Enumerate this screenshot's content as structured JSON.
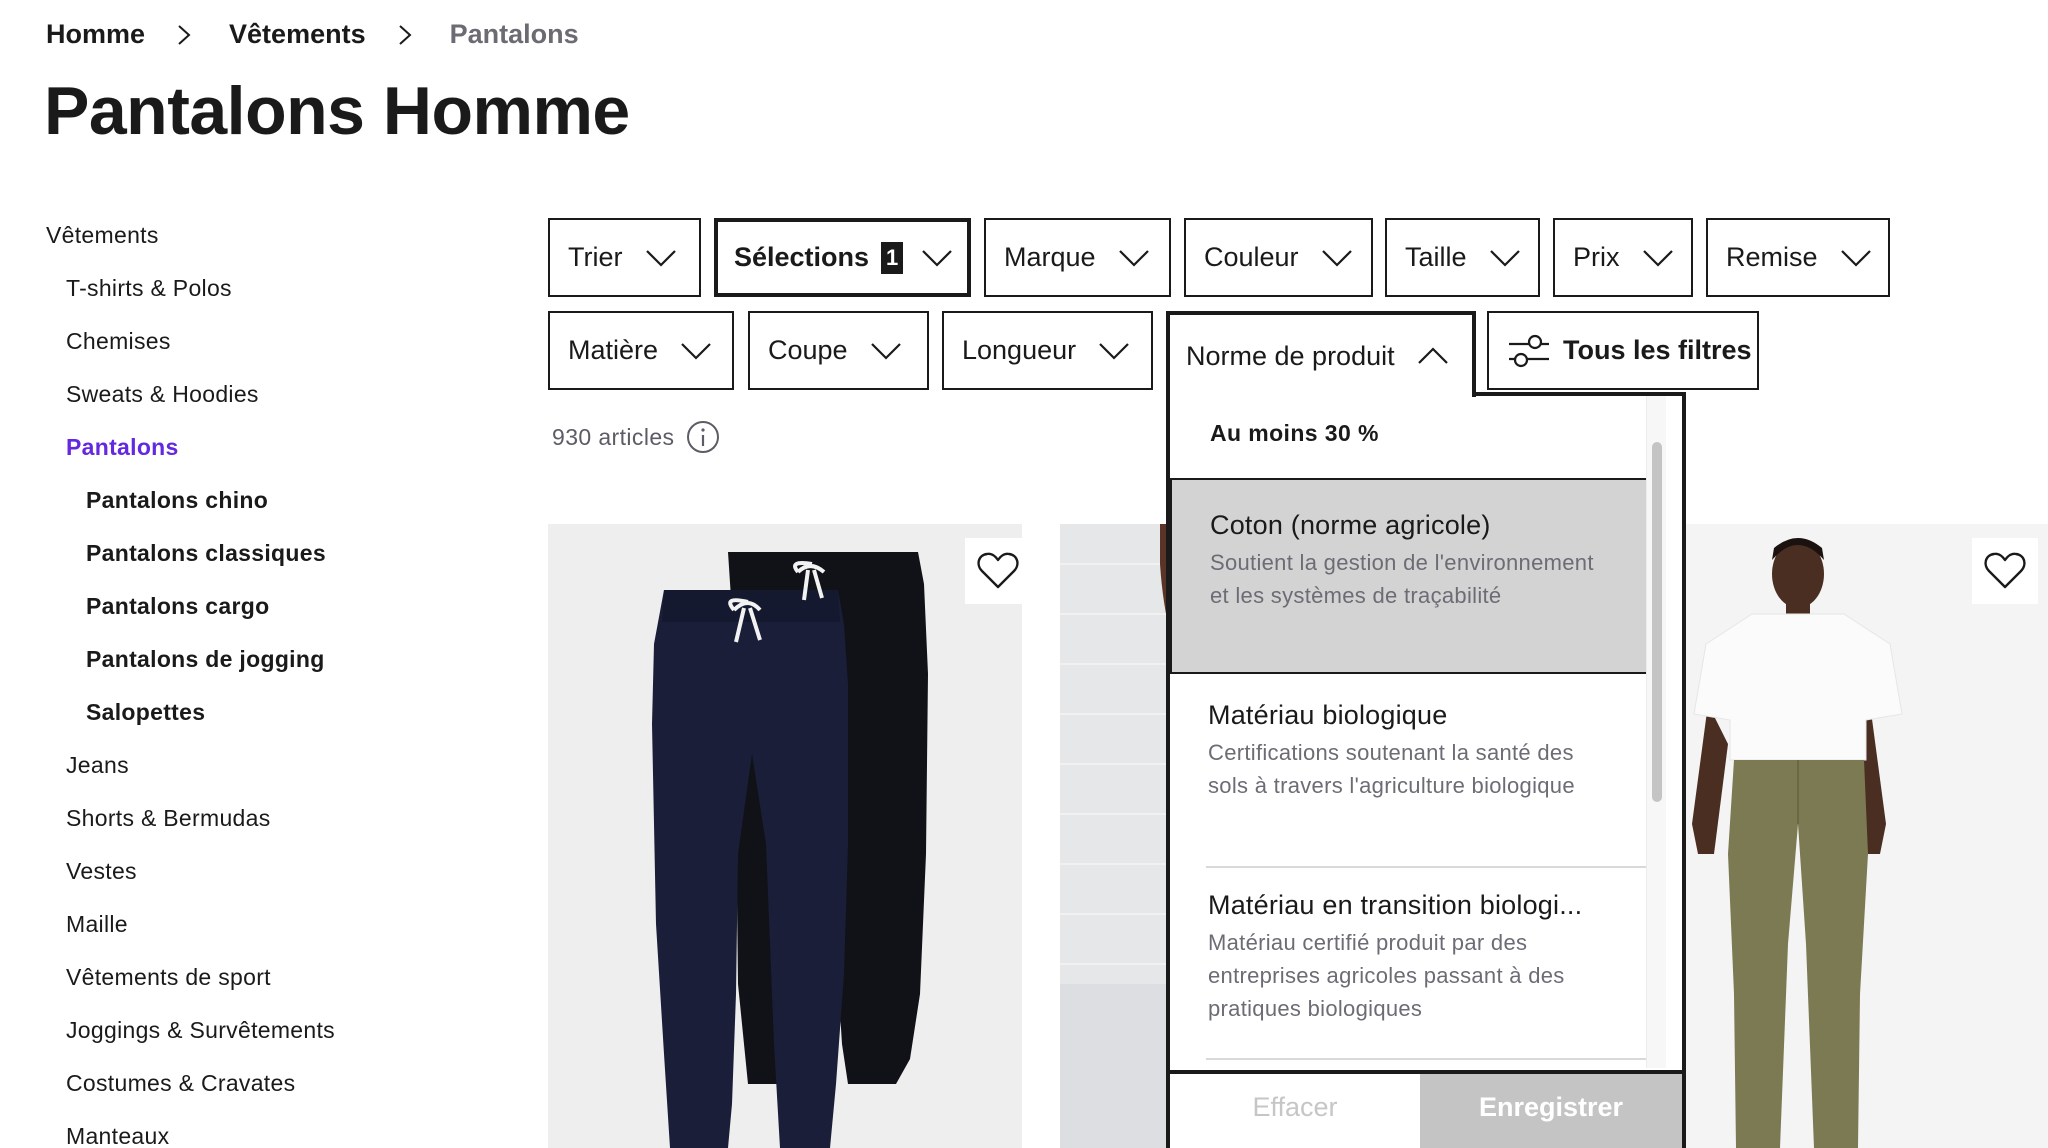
{
  "breadcrumb": [
    {
      "label": "Homme"
    },
    {
      "label": "Vêtements"
    },
    {
      "label": "Pantalons"
    }
  ],
  "page_title": "Pantalons Homme",
  "sidebar": {
    "items": [
      {
        "label": "Vêtements",
        "level": 0
      },
      {
        "label": "T-shirts & Polos",
        "level": 1
      },
      {
        "label": "Chemises",
        "level": 1
      },
      {
        "label": "Sweats & Hoodies",
        "level": 1
      },
      {
        "label": "Pantalons",
        "level": 1,
        "active": true
      },
      {
        "label": "Pantalons chino",
        "level": 2
      },
      {
        "label": "Pantalons classiques",
        "level": 2
      },
      {
        "label": "Pantalons cargo",
        "level": 2
      },
      {
        "label": "Pantalons de jogging",
        "level": 2
      },
      {
        "label": "Salopettes",
        "level": 2
      },
      {
        "label": "Jeans",
        "level": 1
      },
      {
        "label": "Shorts & Bermudas",
        "level": 1
      },
      {
        "label": "Vestes",
        "level": 1
      },
      {
        "label": "Maille",
        "level": 1
      },
      {
        "label": "Vêtements de sport",
        "level": 1
      },
      {
        "label": "Joggings & Survêtements",
        "level": 1
      },
      {
        "label": "Costumes & Cravates",
        "level": 1
      },
      {
        "label": "Manteaux",
        "level": 1
      }
    ],
    "active_color": "#6328e0"
  },
  "filters": {
    "row1": [
      {
        "label": "Trier"
      },
      {
        "label": "Sélections",
        "badge": "1"
      },
      {
        "label": "Marque"
      },
      {
        "label": "Couleur"
      },
      {
        "label": "Taille"
      },
      {
        "label": "Prix"
      },
      {
        "label": "Remise"
      }
    ],
    "row2": [
      {
        "label": "Matière"
      },
      {
        "label": "Coupe"
      },
      {
        "label": "Longueur"
      },
      {
        "label": "Norme de produit",
        "open": true
      }
    ],
    "all_filters_label": "Tous les filtres"
  },
  "results": {
    "count_label": "930 articles",
    "info_icon": "info-icon"
  },
  "dropdown": {
    "header": "Au moins 30 %",
    "options": [
      {
        "title": "Coton (norme agricole)",
        "description": "Soutient la gestion de l'environnement et les systèmes de traçabilité",
        "selected": true
      },
      {
        "title": "Matériau biologique",
        "description": "Certifications soutenant la santé des sols à travers l'agriculture biologique",
        "selected": false
      },
      {
        "title": "Matériau en transition biologi...",
        "description": "Matériau certifié produit par des entreprises agricoles passant à des pratiques biologiques",
        "selected": false
      }
    ],
    "clear_label": "Effacer",
    "save_label": "Enregistrer"
  },
  "products": [
    {
      "name": "product-jogging-pants-2-pack",
      "favorite_icon": "heart-icon"
    },
    {
      "name": "product-partial-hidden"
    },
    {
      "name": "product-chino-olive",
      "favorite_icon": "heart-icon"
    }
  ]
}
